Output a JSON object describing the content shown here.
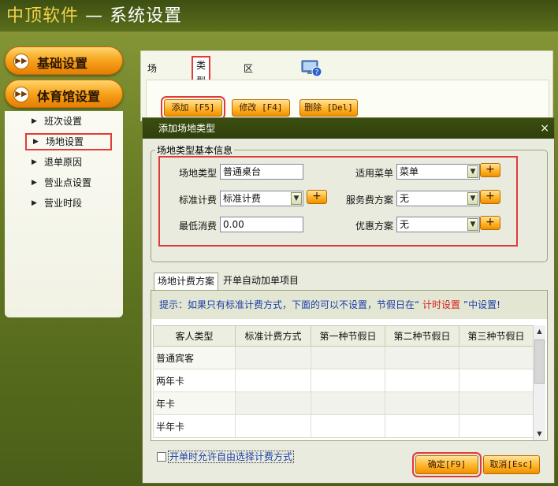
{
  "app": {
    "title": "中顶软件",
    "subtitle": " — 系统设置"
  },
  "nav": {
    "basic": "基础设置",
    "gym": "体育馆设置",
    "items": [
      "班次设置",
      "场地设置",
      "退单原因",
      "营业点设置",
      "营业时段"
    ],
    "selected": "场地设置"
  },
  "top_tabs": [
    "场地设置",
    "类型设置",
    "区域设置"
  ],
  "toolbar": {
    "add": "添加 [F5]",
    "edit": "修改 [F4]",
    "delete": "删除 [Del]"
  },
  "dialog": {
    "title": "添加场地类型",
    "close": "×",
    "group_title": "场地类型基本信息",
    "fields": {
      "type_label": "场地类型",
      "type_value": "普通桌台",
      "menu_label": "适用菜单",
      "menu_value": "菜单",
      "billing_label": "标准计费",
      "billing_value": "标准计费",
      "service_label": "服务费方案",
      "service_value": "无",
      "min_label": "最低消费",
      "min_value": "0.00",
      "discount_label": "优惠方案",
      "discount_value": "无"
    },
    "sub_tabs": [
      "场地计费方案",
      "开单自动加单项目"
    ],
    "hint_prefix": "提示：如果只有标准计费方式，下面的可以不设置，节假日在“ ",
    "hint_link": "计时设置",
    "hint_suffix": " ”中设置!",
    "grid": {
      "columns": [
        "客人类型",
        "标准计费方式",
        "第一种节假日",
        "第二种节假日",
        "第三种节假日"
      ],
      "rows": [
        "普通宾客",
        "两年卡",
        "年卡",
        "半年卡"
      ]
    },
    "checkbox_label": "开单时允许自由选择计费方式",
    "ok": "确定[F9]",
    "cancel": "取消[Esc]"
  },
  "colors": {
    "accent_orange": "#f7a21a",
    "highlight_red": "#e13a3a",
    "dark_green": "#3b4e10"
  }
}
